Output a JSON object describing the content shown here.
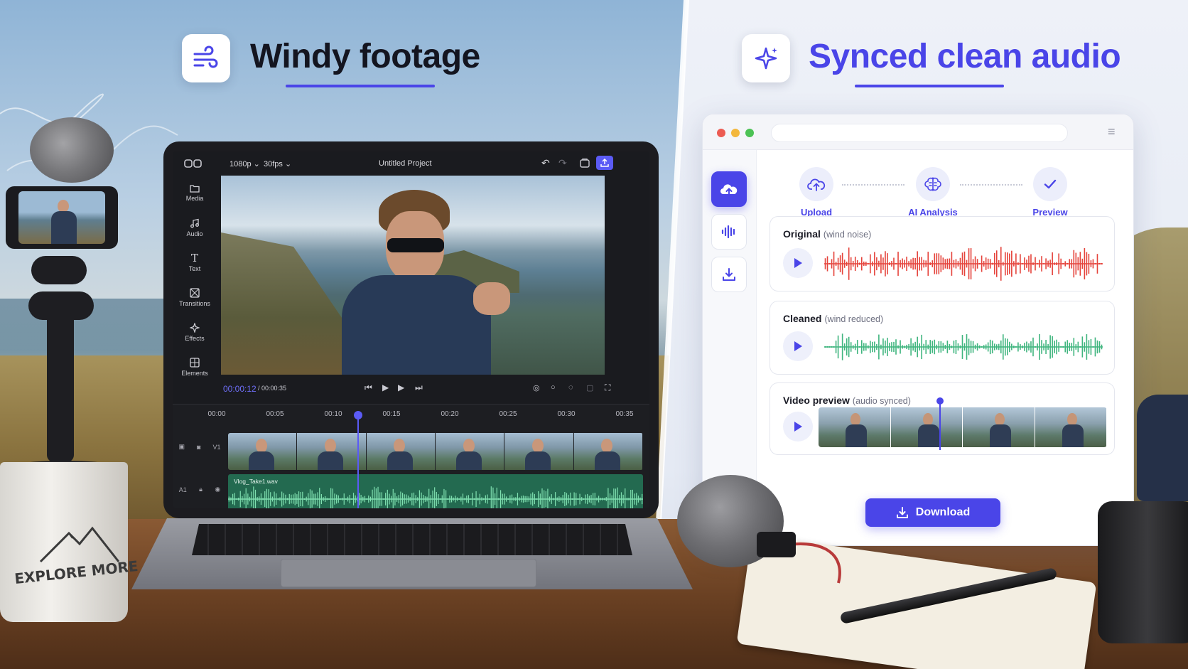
{
  "left_panel": {
    "title": "Windy footage",
    "icon": "wind-icon",
    "mug_text": "EXPLORE MORE"
  },
  "right_panel": {
    "title": "Synced clean audio",
    "icon": "sparkles-icon"
  },
  "colors": {
    "accent": "#4a45e8",
    "original_wave": "#e5433b",
    "cleaned_wave": "#3fb57e",
    "editor_bg": "#1a1b1f",
    "audio_track": "#236a50"
  },
  "editor": {
    "toolbar": {
      "resolution": "1080p",
      "fps": "30fps",
      "project_name": "Untitled Project"
    },
    "sidebar": [
      {
        "label": "Media",
        "icon": "folder-icon"
      },
      {
        "label": "Audio",
        "icon": "music-note-icon"
      },
      {
        "label": "Text",
        "icon": "text-icon"
      },
      {
        "label": "Transitions",
        "icon": "transitions-icon"
      },
      {
        "label": "Effects",
        "icon": "effects-icon"
      },
      {
        "label": "Elements",
        "icon": "elements-icon"
      }
    ],
    "time_current": "00:00:12",
    "time_total": "/ 00:00:35",
    "ruler": [
      "00:00",
      "00:05",
      "00:10",
      "00:15",
      "00:20",
      "00:25",
      "00:30",
      "00:35"
    ],
    "video_track_label": "V1",
    "audio_track_label": "A1",
    "audio_clip_name": "Vlog_Take1.wav"
  },
  "app": {
    "steps": [
      {
        "label": "Upload",
        "icon": "cloud-upload-icon"
      },
      {
        "label": "AI Analysis",
        "icon": "brain-icon"
      },
      {
        "label": "Preview",
        "icon": "check-icon"
      }
    ],
    "rail_icons": [
      "cloud-upload-icon",
      "waveform-icon",
      "download-icon"
    ],
    "original": {
      "title": "Original",
      "sub": "(wind noise)"
    },
    "cleaned": {
      "title": "Cleaned",
      "sub": "(wind reduced)"
    },
    "video_preview": {
      "title": "Video preview",
      "sub": "(audio synced)"
    },
    "download_label": "Download"
  }
}
